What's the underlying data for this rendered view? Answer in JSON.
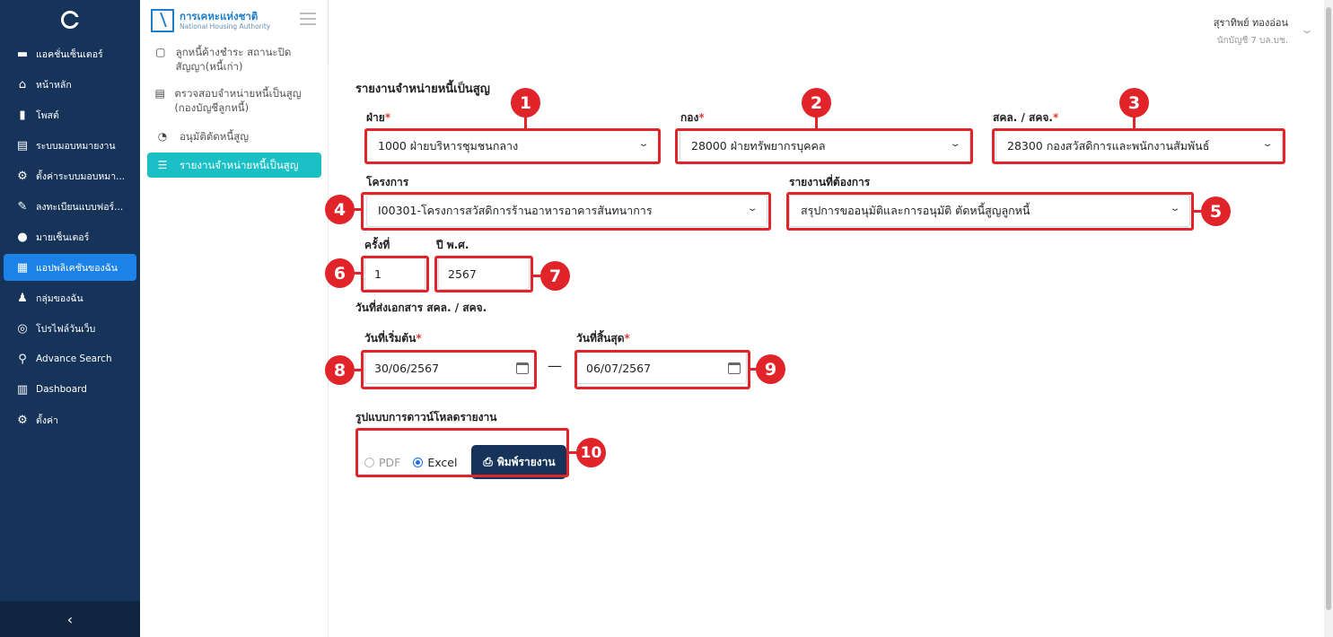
{
  "sidebar": {
    "items": [
      {
        "label": "แอคชั่นเซ็นเตอร์",
        "icon": "inbox-icon",
        "glyph": "▬"
      },
      {
        "label": "หน้าหลัก",
        "icon": "home-icon",
        "glyph": "⌂"
      },
      {
        "label": "โพสต์",
        "icon": "post-icon",
        "glyph": "▮"
      },
      {
        "label": "ระบบมอบหมายงาน",
        "icon": "document-icon",
        "glyph": "▤"
      },
      {
        "label": "ตั้งค่าระบบมอบหมา...",
        "icon": "settings-gear-icon",
        "glyph": "⚙"
      },
      {
        "label": "ลงทะเบียนแบบฟอร์...",
        "icon": "edit-form-icon",
        "glyph": "✎"
      },
      {
        "label": "มายเซ็นเตอร์",
        "icon": "user-icon",
        "glyph": "●"
      },
      {
        "label": "แอปพลิเคชันของฉัน",
        "icon": "apps-grid-icon",
        "glyph": "▦"
      },
      {
        "label": "กลุ่มของฉัน",
        "icon": "group-icon",
        "glyph": "♟"
      },
      {
        "label": "โปรไฟล์วันเว็บ",
        "icon": "profile-icon",
        "glyph": "◎"
      },
      {
        "label": "Advance Search",
        "icon": "search-icon",
        "glyph": "⚲"
      },
      {
        "label": "Dashboard",
        "icon": "dashboard-chart-icon",
        "glyph": "▥"
      },
      {
        "label": "ตั้งค่า",
        "icon": "settings-icon",
        "glyph": "⚙"
      }
    ],
    "active_index": 7,
    "collapse_glyph": "‹"
  },
  "brand": {
    "name_th": "การเคหะแห่งชาติ",
    "name_en": "National Housing Authority"
  },
  "menu": {
    "items": [
      {
        "label": "ลูกหนี้ค้างชำระ สถานะปิดสัญญา(หนี้เก่า)",
        "glyph": "▢"
      },
      {
        "label": "ตรวจสอบจำหน่ายหนี้เป็นสูญ (กองบัญชีลูกหนี้)",
        "glyph": "▤"
      },
      {
        "label": "อนุมัติตัดหนี้สูญ",
        "glyph": "◔"
      },
      {
        "label": "รายงานจำหน่ายหนี้เป็นสูญ",
        "glyph": "☰"
      }
    ],
    "active_index": 3
  },
  "user": {
    "name": "สุราทิพย์ ทองอ่อน",
    "role": "นักบัญชี 7 บล.บช."
  },
  "page": {
    "title": "รายงานจำหน่ายหนี้เป็นสูญ"
  },
  "form": {
    "division": {
      "label": "ฝ่าย",
      "value": "1000 ฝ่ายบริหารชุมชนกลาง"
    },
    "department": {
      "label": "กอง",
      "value": "28000 ฝ่ายทรัพยากรบุคคล"
    },
    "office": {
      "label": "สคล. / สคจ.",
      "value": "28300 กองสวัสดิการและพนักงานสัมพันธ์"
    },
    "project": {
      "label": "โครงการ",
      "value": "I00301-โครงการสวัสดิการร้านอาหารอาคารสันทนาการ"
    },
    "report": {
      "label": "รายงานที่ต้องการ",
      "value": "สรุปการขออนุมัติและการอนุมัติ ตัดหนี้สูญลูกหนี้"
    },
    "round": {
      "label": "ครั้งที่",
      "value": "1"
    },
    "year": {
      "label": "ปี พ.ศ.",
      "value": "2567"
    },
    "date_section": "วันที่ส่งเอกสาร สคล. / สคจ.",
    "start_date": {
      "label": "วันที่เริ่มต้น",
      "value": "30/06/2567"
    },
    "end_date": {
      "label": "วันที่สิ้นสุด",
      "value": "06/07/2567"
    },
    "date_separator": "—",
    "download_label": "รูปแบบการดาวน์โหลดรายงาน",
    "format_options": [
      "PDF",
      "Excel"
    ],
    "selected_format": "Excel",
    "print_label": "พิมพ์รายงาน",
    "required_mark": "*"
  },
  "annotations": [
    "1",
    "2",
    "3",
    "4",
    "5",
    "6",
    "7",
    "8",
    "9",
    "10"
  ],
  "colors": {
    "sidebar_bg": "#16345a",
    "active_blue": "#1c82e8",
    "active_teal": "#1ac0c6",
    "highlight_red": "#e0242a",
    "button_navy": "#16345a"
  }
}
